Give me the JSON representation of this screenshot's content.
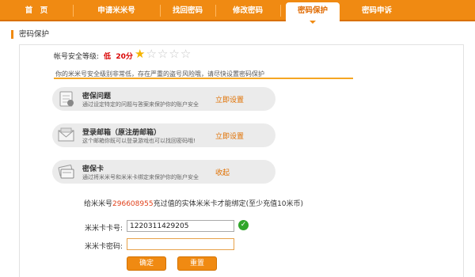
{
  "nav": {
    "items": [
      {
        "label": "首　页"
      },
      {
        "label": "申请米米号"
      },
      {
        "label": "找回密码"
      },
      {
        "label": "修改密码"
      },
      {
        "label": "密码保护"
      },
      {
        "label": "密码申诉"
      }
    ]
  },
  "section_title": "密码保护",
  "security": {
    "label": "帐号安全等级:",
    "level": "低",
    "score": "20分",
    "rating": 1,
    "max_rating": 5,
    "warning": "你的米米号安全级别非常低，存在严重的盗号风险哦，请尽快设置密码保护"
  },
  "options": [
    {
      "title": "密保问题",
      "desc": "通过设定特定的问题与答案来保护你的账户安全",
      "action": "立即设置",
      "icon": "question-doc-icon"
    },
    {
      "title": "登录邮箱（原注册邮箱）",
      "desc": "这个邮箱你既可以登录游戏也可以找回密码哦!",
      "action": "立即设置",
      "icon": "email-icon"
    },
    {
      "title": "密保卡",
      "desc": "通过将米米号和米米卡绑定来保护你的账户安全",
      "action": "收起",
      "icon": "card-icon"
    }
  ],
  "bind": {
    "prefix": "给米米号",
    "number": "296608955",
    "suffix": "充过值的实体米米卡才能绑定(至少充值10米币)"
  },
  "form": {
    "card_label": "米米卡卡号:",
    "card_value": "1220311429205",
    "pwd_label": "米米卡密码:",
    "pwd_value": ""
  },
  "buttons": {
    "confirm": "确定",
    "reset": "重置"
  },
  "colors": {
    "accent": "#f08a12",
    "danger": "#d90000",
    "link": "#e07000",
    "success": "#2fa52a"
  }
}
